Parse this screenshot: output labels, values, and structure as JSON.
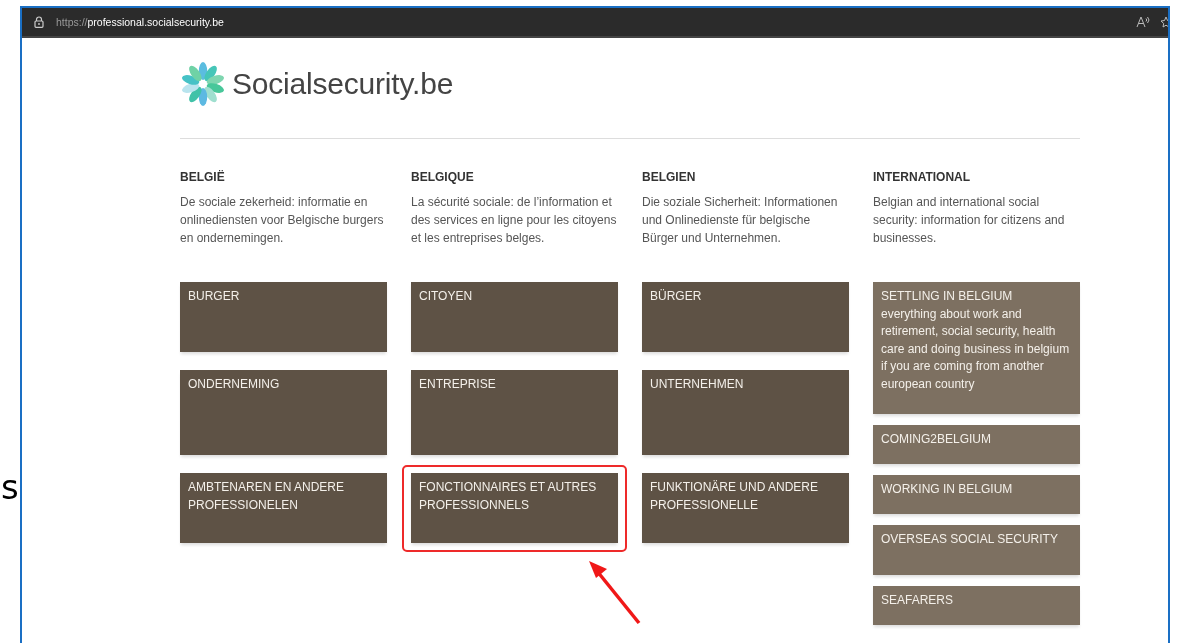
{
  "side_text": "s",
  "browser": {
    "url_scheme": "https://",
    "url_host": "professional.socialsecurity.be"
  },
  "logo": {
    "text": "Socialsecurity.be"
  },
  "columns": [
    {
      "heading": "BELGIË",
      "description": "De sociale zekerheid: informatie en onlinediensten voor Belgische burgers en ondernemingen.",
      "kind": "region",
      "tiles": [
        {
          "title": "BURGER",
          "highlighted": false
        },
        {
          "title": "ONDERNEMING",
          "highlighted": false
        },
        {
          "title": "AMBTENAREN EN ANDERE PROFESSIONELEN",
          "highlighted": false
        }
      ]
    },
    {
      "heading": "BELGIQUE",
      "description": "La sécurité sociale: de l’information et des services en ligne pour les citoyens et les entreprises belges.",
      "kind": "region",
      "tiles": [
        {
          "title": "CITOYEN",
          "highlighted": false
        },
        {
          "title": "ENTREPRISE",
          "highlighted": false
        },
        {
          "title": "FONCTIONNAIRES ET AUTRES PROFESSIONNELS",
          "highlighted": true
        }
      ]
    },
    {
      "heading": "BELGIEN",
      "description": "Die soziale Sicherheit: Informationen und Onlinedienste für belgische Bürger und Unternehmen.",
      "kind": "region",
      "tiles": [
        {
          "title": "BÜRGER",
          "highlighted": false
        },
        {
          "title": "UNTERNEHMEN",
          "highlighted": false
        },
        {
          "title": "FUNKTIONÄRE UND ANDERE PROFESSIONELLE",
          "highlighted": false
        }
      ]
    },
    {
      "heading": "INTERNATIONAL",
      "description": "Belgian and international social security: information for citizens and businesses.",
      "kind": "international",
      "tiles": [
        {
          "title": "SETTLING IN BELGIUM",
          "subtitle": "everything about work and retirement, social security, health care and doing business in belgium if you are coming from another european country",
          "highlighted": false
        },
        {
          "title": "COMING2BELGIUM",
          "highlighted": false
        },
        {
          "title": "WORKING IN BELGIUM",
          "highlighted": false
        },
        {
          "title": "OVERSEAS SOCIAL SECURITY",
          "highlighted": false
        },
        {
          "title": "SEAFARERS",
          "highlighted": false
        }
      ]
    }
  ]
}
